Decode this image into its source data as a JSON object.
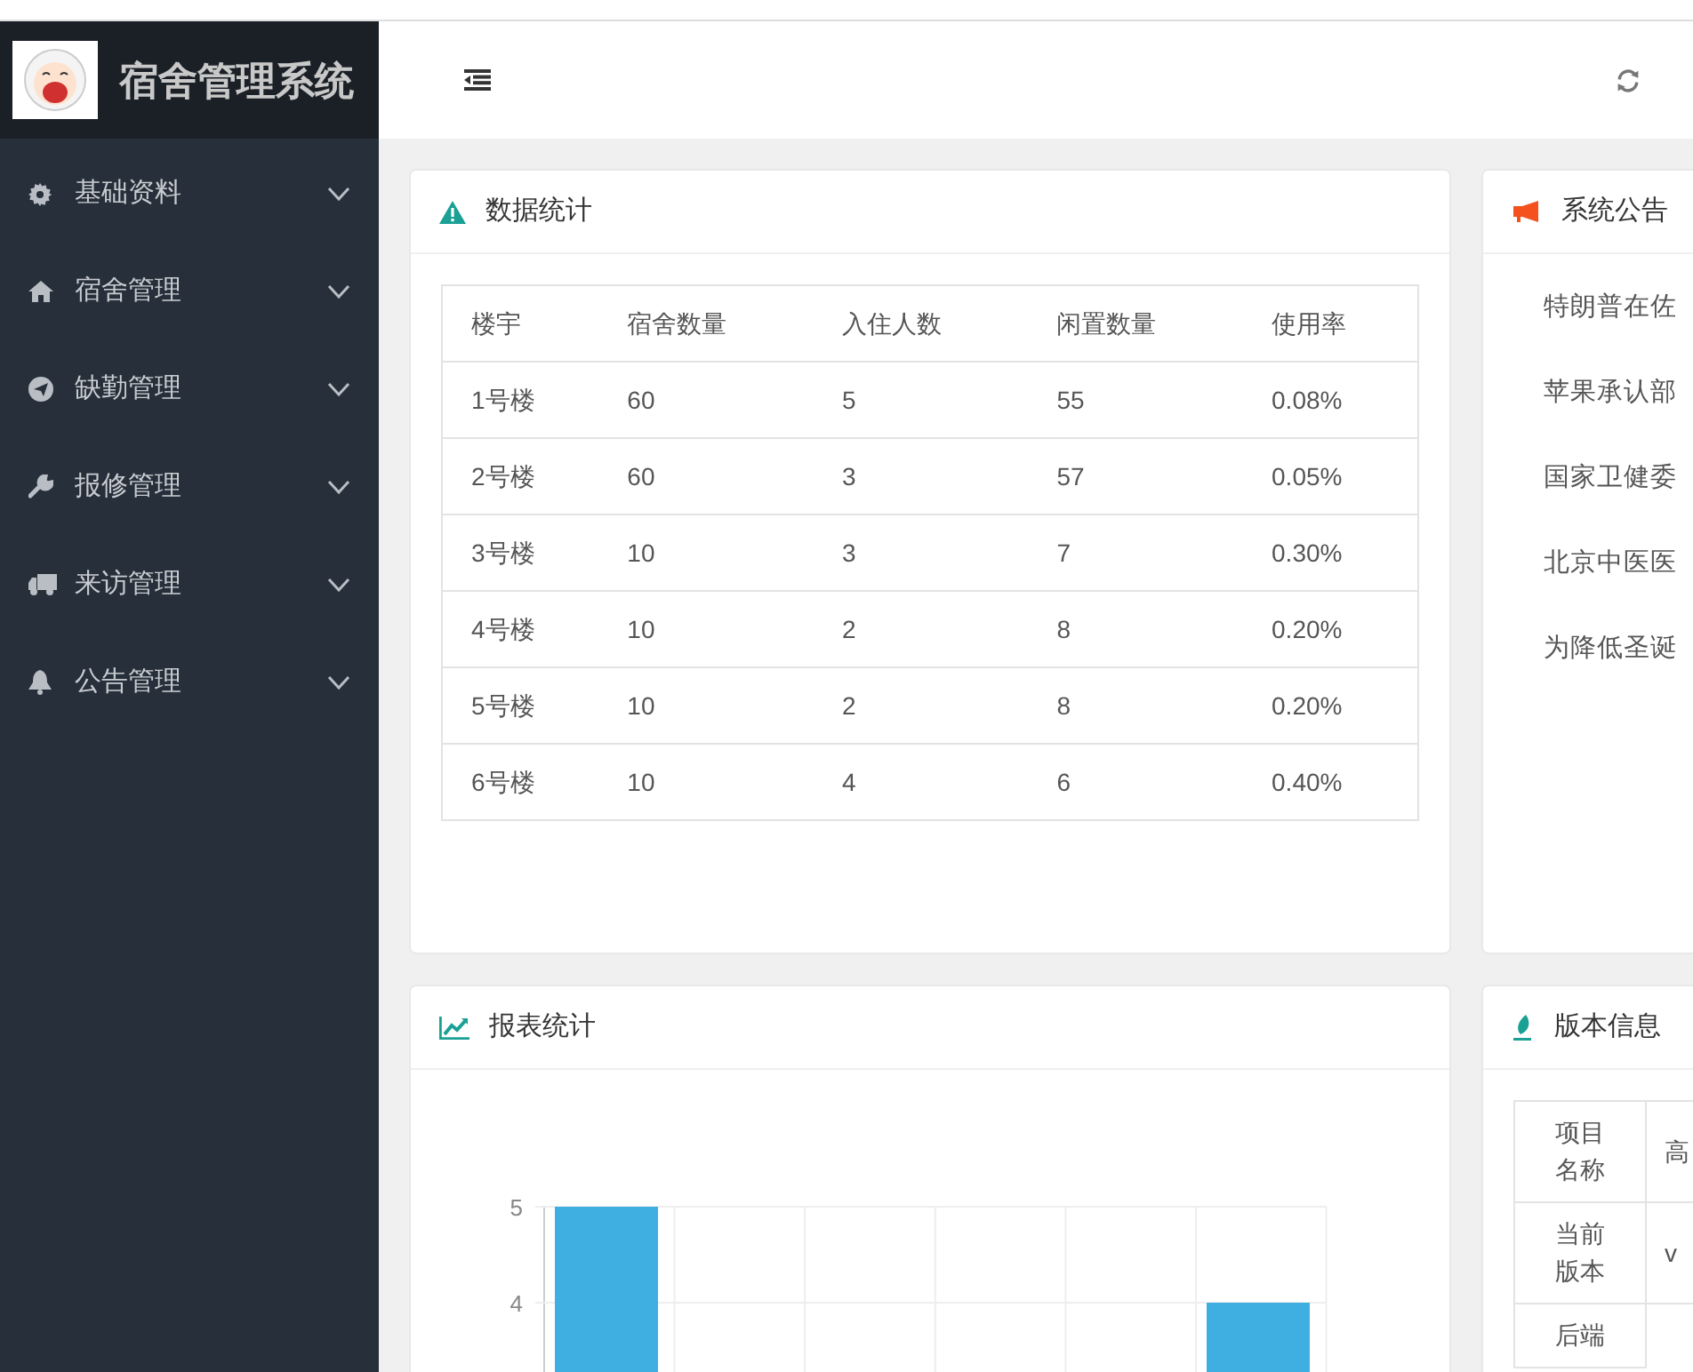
{
  "sidebar": {
    "brand": "宿舍管理系统",
    "items": [
      {
        "label": "基础资料",
        "expanded": false
      },
      {
        "label": "宿舍管理",
        "expanded": false
      },
      {
        "label": "缺勤管理",
        "expanded": false
      },
      {
        "label": "报修管理",
        "expanded": false
      },
      {
        "label": "来访管理",
        "expanded": false
      },
      {
        "label": "公告管理",
        "expanded": false
      }
    ]
  },
  "stats_card": {
    "title": "数据统计",
    "table": {
      "columns": [
        "楼宇",
        "宿舍数量",
        "入住人数",
        "闲置数量",
        "使用率"
      ],
      "rows": [
        [
          "1号楼",
          "60",
          "5",
          "55",
          "0.08%"
        ],
        [
          "2号楼",
          "60",
          "3",
          "57",
          "0.05%"
        ],
        [
          "3号楼",
          "10",
          "3",
          "7",
          "0.30%"
        ],
        [
          "4号楼",
          "10",
          "2",
          "8",
          "0.20%"
        ],
        [
          "5号楼",
          "10",
          "2",
          "8",
          "0.20%"
        ],
        [
          "6号楼",
          "10",
          "4",
          "6",
          "0.40%"
        ]
      ]
    }
  },
  "notice_card": {
    "title": "系统公告",
    "items": [
      "特朗普在佐",
      "苹果承认部",
      "国家卫健委",
      "北京中医医",
      "为降低圣诞"
    ]
  },
  "report_card": {
    "title": "报表统计",
    "chart_data": {
      "type": "bar",
      "ylim": [
        0,
        5
      ],
      "yticks": [
        4,
        5
      ],
      "series": [
        {
          "color": "#3eafe0",
          "values": [
            5,
            null,
            null,
            null,
            null,
            4
          ]
        }
      ]
    }
  },
  "version_card": {
    "title": "版本信息",
    "rows": [
      [
        "项目名称",
        "高"
      ],
      [
        "当前版本",
        "v"
      ],
      [
        "后端"
      ]
    ]
  }
}
